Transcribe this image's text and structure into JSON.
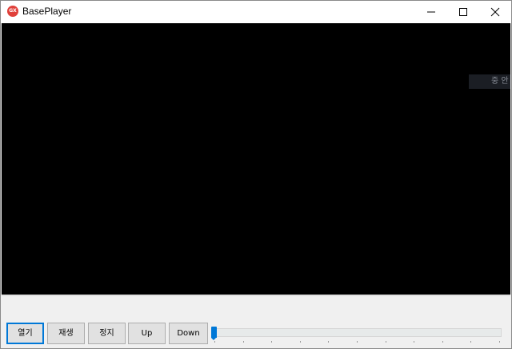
{
  "window": {
    "title": "BasePlayer",
    "icon_text": "GX",
    "icon_color": "#e0403a",
    "controls": [
      "minimize-icon",
      "maximize-icon",
      "close-icon"
    ]
  },
  "video": {
    "background": "#000000",
    "overlay_text": "중 안"
  },
  "controls": {
    "open_label": "열기",
    "play_label": "재생",
    "stop_label": "정지",
    "up_label": "Up",
    "down_label": "Down"
  },
  "slider": {
    "value_fraction": 0.0,
    "accent": "#0078d7"
  }
}
